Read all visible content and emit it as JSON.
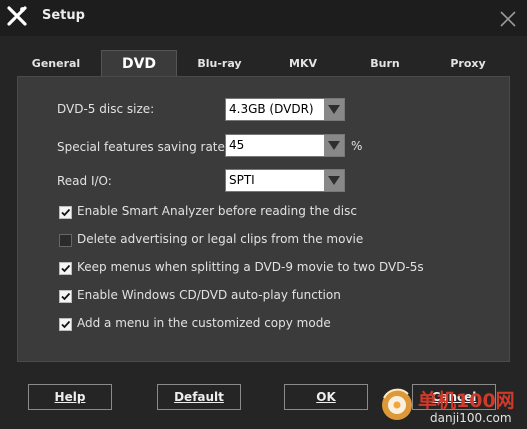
{
  "window": {
    "title": "Setup"
  },
  "tabs": [
    {
      "label": "General",
      "active": false
    },
    {
      "label": "DVD",
      "active": true
    },
    {
      "label": "Blu-ray",
      "active": false
    },
    {
      "label": "MKV",
      "active": false
    },
    {
      "label": "Burn",
      "active": false
    },
    {
      "label": "Proxy",
      "active": false
    }
  ],
  "dvd": {
    "disc_size": {
      "label": "DVD-5 disc size:",
      "value": "4.3GB (DVDR)"
    },
    "saving_rate": {
      "label": "Special features saving rate:",
      "value": "45",
      "unit": "%"
    },
    "read_io": {
      "label": "Read I/O:",
      "value": "SPTI"
    },
    "options": [
      {
        "label": "Enable Smart Analyzer before reading the disc",
        "checked": true
      },
      {
        "label": "Delete advertising or legal clips from the movie",
        "checked": false
      },
      {
        "label": "Keep menus when splitting a DVD-9 movie to two DVD-5s",
        "checked": true
      },
      {
        "label": "Enable Windows CD/DVD auto-play function",
        "checked": true
      },
      {
        "label": "Add a menu in the customized copy mode",
        "checked": true
      }
    ]
  },
  "footer": {
    "help": "Help",
    "default": "Default",
    "ok": "OK",
    "cancel": "Cancel"
  },
  "watermark": {
    "line1": "单机100网",
    "line2": "danji100.com"
  },
  "icons": {
    "app": "dvdfab-x-icon",
    "close": "close-icon",
    "dropdown": "triangle-down-icon",
    "check": "checkmark-icon"
  }
}
